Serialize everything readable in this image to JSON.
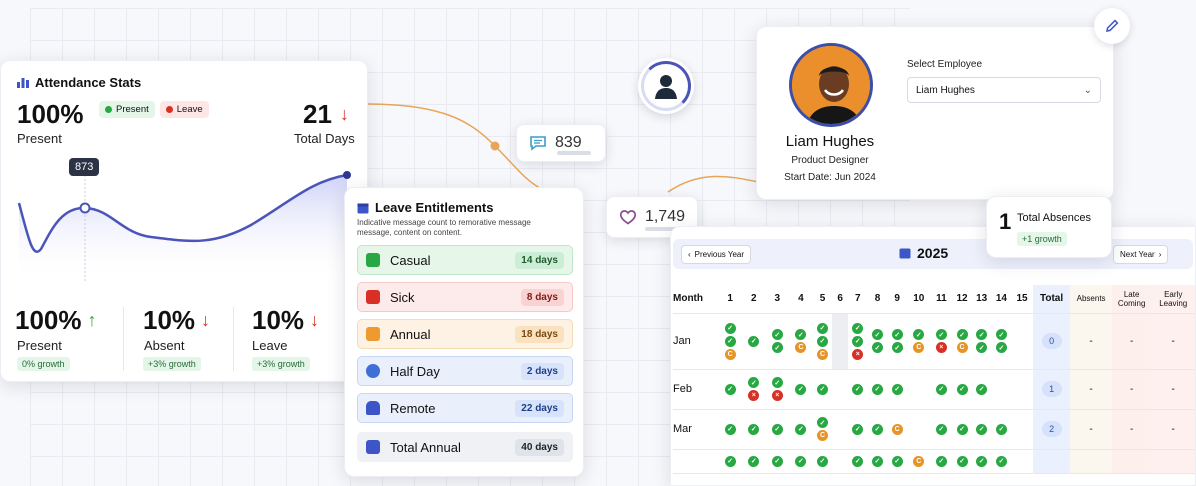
{
  "stats": {
    "title": "Attendance Stats",
    "present_pct": "100%",
    "present_label": "Present",
    "legend_present": "Present",
    "legend_leave": "Leave",
    "total_days": "21",
    "total_days_label": "Total Days",
    "tooltip_value": "873",
    "metrics": [
      {
        "value": "100%",
        "label": "Present",
        "growth": "0% growth",
        "trend": "up"
      },
      {
        "value": "10%",
        "label": "Absent",
        "growth": "+3% growth",
        "trend": "down"
      },
      {
        "value": "10%",
        "label": "Leave",
        "growth": "+3% growth",
        "trend": "down"
      }
    ],
    "colors": {
      "present": "#27a843",
      "leave": "#d93025",
      "line": "#4b54b8"
    }
  },
  "badges": {
    "messages": "839",
    "likes": "1,749"
  },
  "leave": {
    "title": "Leave Entitlements",
    "description": "Indicative message count to remorative message message, content on content.",
    "items": [
      {
        "label": "Casual",
        "days": "14 days",
        "icon": "id-card-icon"
      },
      {
        "label": "Sick",
        "days": "8 days",
        "icon": "medical-kit-icon"
      },
      {
        "label": "Annual",
        "days": "18 days",
        "icon": "folder-icon"
      },
      {
        "label": "Half Day",
        "days": "2 days",
        "icon": "clock-icon"
      },
      {
        "label": "Remote",
        "days": "22 days",
        "icon": "car-icon"
      },
      {
        "label": "Total Annual",
        "days": "40 days",
        "icon": "calendar-icon"
      }
    ]
  },
  "profile": {
    "name": "Liam Hughes",
    "role": "Product Designer",
    "start_date": "Start Date: Jun 2024",
    "select_label": "Select Employee",
    "selected": "Liam Hughes"
  },
  "absences": {
    "value": "1",
    "label": "Total Absences",
    "growth": "+1 growth"
  },
  "calendar": {
    "prev": "Previous Year",
    "next": "Next Year",
    "year": "2025",
    "headers": [
      "Month",
      "1",
      "2",
      "3",
      "4",
      "5",
      "6",
      "7",
      "8",
      "9",
      "10",
      "11",
      "12",
      "13",
      "14",
      "15",
      "Total",
      "Absents",
      "Late Coming",
      "Early Leaving"
    ],
    "rows": [
      {
        "month": "Jan",
        "total": "0",
        "absents": "-",
        "late": "-",
        "early": "-",
        "days": [
          "g|g|o",
          "g",
          "g|g",
          "g|o",
          "g|g|o",
          "",
          "g|g|r",
          "g|g",
          "g|g",
          "g|o",
          "g|r",
          "g|o",
          "g|g",
          "g|g",
          ""
        ]
      },
      {
        "month": "Feb",
        "total": "1",
        "absents": "-",
        "late": "-",
        "early": "-",
        "days": [
          "g",
          "g|r",
          "g|r",
          "g",
          "g",
          "",
          "g",
          "g",
          "g",
          "",
          "g",
          "g",
          "g",
          "",
          ""
        ]
      },
      {
        "month": "Mar",
        "total": "2",
        "absents": "-",
        "late": "-",
        "early": "-",
        "days": [
          "g",
          "g",
          "g",
          "g",
          "g|o",
          "",
          "g",
          "g",
          "o",
          "",
          "g",
          "g",
          "g",
          "g",
          ""
        ]
      },
      {
        "month": "",
        "total": "",
        "absents": "",
        "late": "",
        "early": "",
        "days": [
          "g",
          "g",
          "g",
          "g",
          "g",
          "",
          "g",
          "g",
          "g",
          "o",
          "g",
          "g",
          "g",
          "g",
          ""
        ]
      }
    ]
  }
}
